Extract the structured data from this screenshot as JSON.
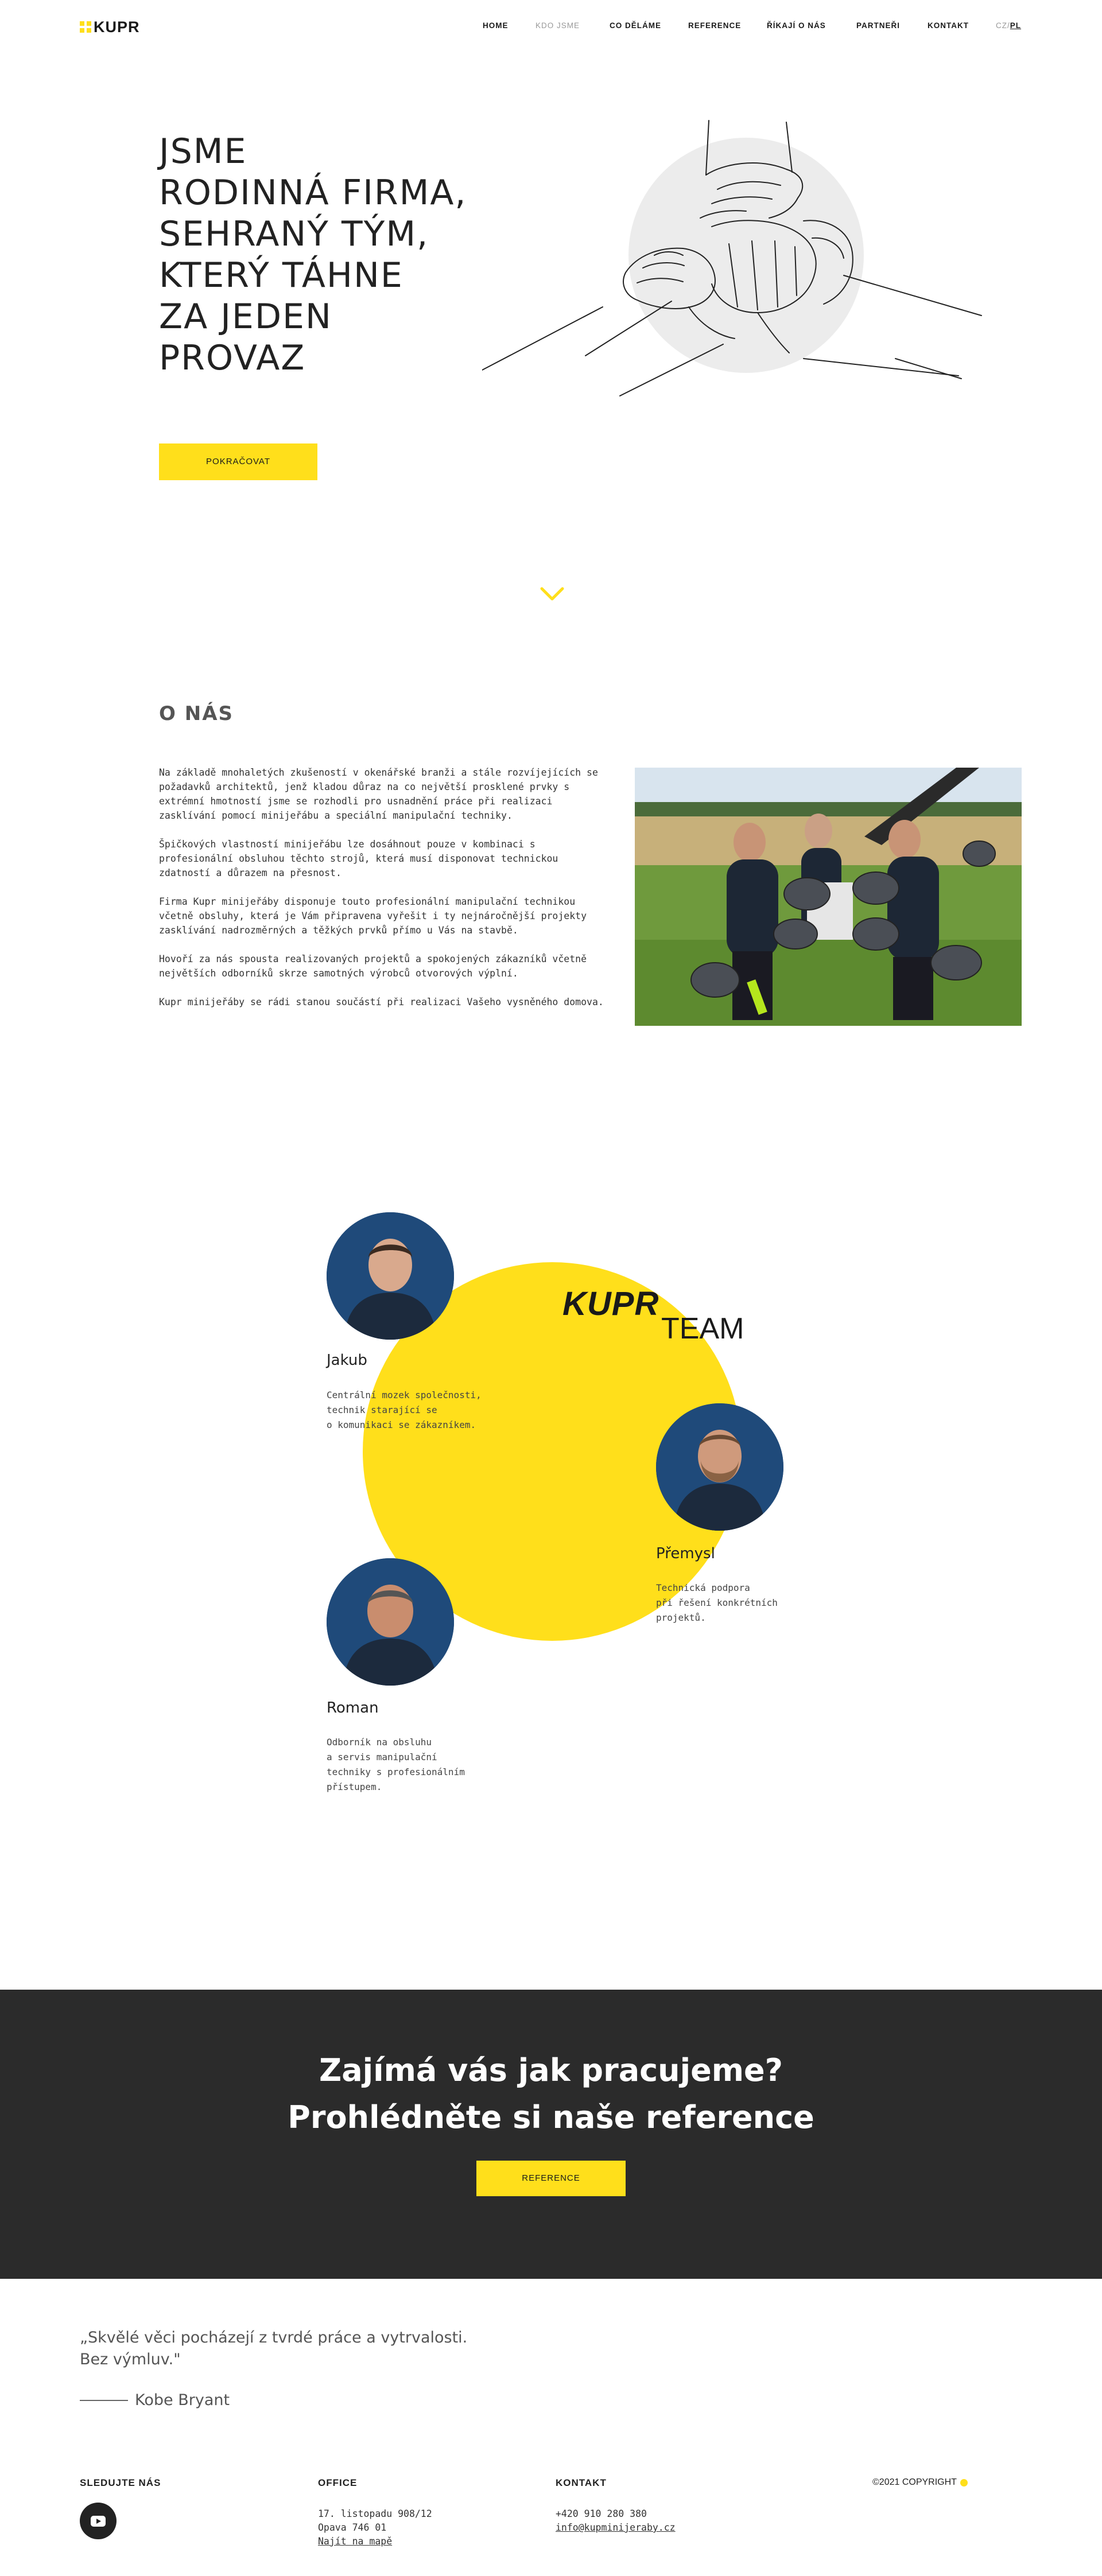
{
  "header": {
    "logo": "KUPR",
    "nav": [
      {
        "label": "HOME",
        "active": false
      },
      {
        "label": "KDO JSME",
        "active": true
      },
      {
        "label": "CO DĚLÁME",
        "active": false
      },
      {
        "label": "REFERENCE",
        "active": false
      },
      {
        "label": "ŘÍKAJÍ O NÁS",
        "active": false
      },
      {
        "label": "PARTNEŘI",
        "active": false
      },
      {
        "label": "KONTAKT",
        "active": false
      }
    ],
    "lang": {
      "cz": "CZ",
      "sep": "/",
      "pl": "PL"
    }
  },
  "hero": {
    "title_lines": [
      "JSME",
      "RODINNÁ FIRMA,",
      "SEHRANÝ TÝM,",
      "KTERÝ TÁHNE",
      "ZA JEDEN",
      "PROVAZ"
    ],
    "button": "POKRAČOVAT"
  },
  "about": {
    "title": "O NÁS",
    "paragraphs": [
      "Na základě mnohaletých zkušeností v okenářské branži a stále rozvíjejících se požadavků architektů, jenž kladou důraz na co největší prosklené prvky s extrémní hmotností jsme se rozhodli pro usnadnění práce při realizaci zasklívání pomocí minijeřábu a speciální manipulační techniky.",
      "Špičkových vlastností minijeřábu lze dosáhnout pouze v kombinaci s profesionální obsluhou těchto strojů, která musí disponovat technickou zdatností a důrazem na přesnost.",
      "Firma Kupr minijeřáby disponuje touto profesionální manipulační technikou včetně obsluhy, která je Vám připravena vyřešit i ty nejnáročnější projekty zasklívání nadrozměrných a těžkých prvků přímo u Vás na stavbě.",
      "Hovoří za nás spousta realizovaných projektů a spokojených zákazníků včetně největších odborníků skrze samotných výrobců otvorových výplní.",
      "Kupr minijeřáby se rádi stanou součástí při realizaci Vašeho vysněného domova."
    ]
  },
  "team": {
    "logo_main": "KUPR",
    "logo_sub": "TEAM",
    "members": [
      {
        "name": "Jakub",
        "desc": [
          "Centrální mozek společnosti,",
          "technik starající se",
          "o komunikaci se zákazníkem."
        ]
      },
      {
        "name": "Přemysl",
        "desc": [
          "Technická podpora",
          "při řešení konkrétních",
          "projektů."
        ]
      },
      {
        "name": "Roman",
        "desc": [
          "Odborník na obsluhu",
          "a servis manipulační",
          "techniky s profesionálním",
          "přístupem."
        ]
      }
    ]
  },
  "cta": {
    "line1": "Zajímá vás jak pracujeme?",
    "line2": "Prohlédněte si naše reference",
    "button": "REFERENCE"
  },
  "quote": {
    "line1": "„Skvělé věci pocházejí z tvrdé práce a vytrvalosti.",
    "line2": "Bez výmluv.\"",
    "author": "Kobe Bryant"
  },
  "footer": {
    "follow_label": "SLEDUJTE NÁS",
    "office_label": "OFFICE",
    "office_lines": [
      "17. listopadu 908/12",
      "Opava 746 01"
    ],
    "office_map": "Najít na mapě",
    "contact_label": "KONTAKT",
    "phone": "+420 910 280 380",
    "email": "info@kupminijeraby.cz",
    "copyright": "©2021 COPYRIGHT"
  },
  "colors": {
    "accent": "#ffdf1b",
    "dark": "#2b2b2b",
    "text": "#222222"
  }
}
